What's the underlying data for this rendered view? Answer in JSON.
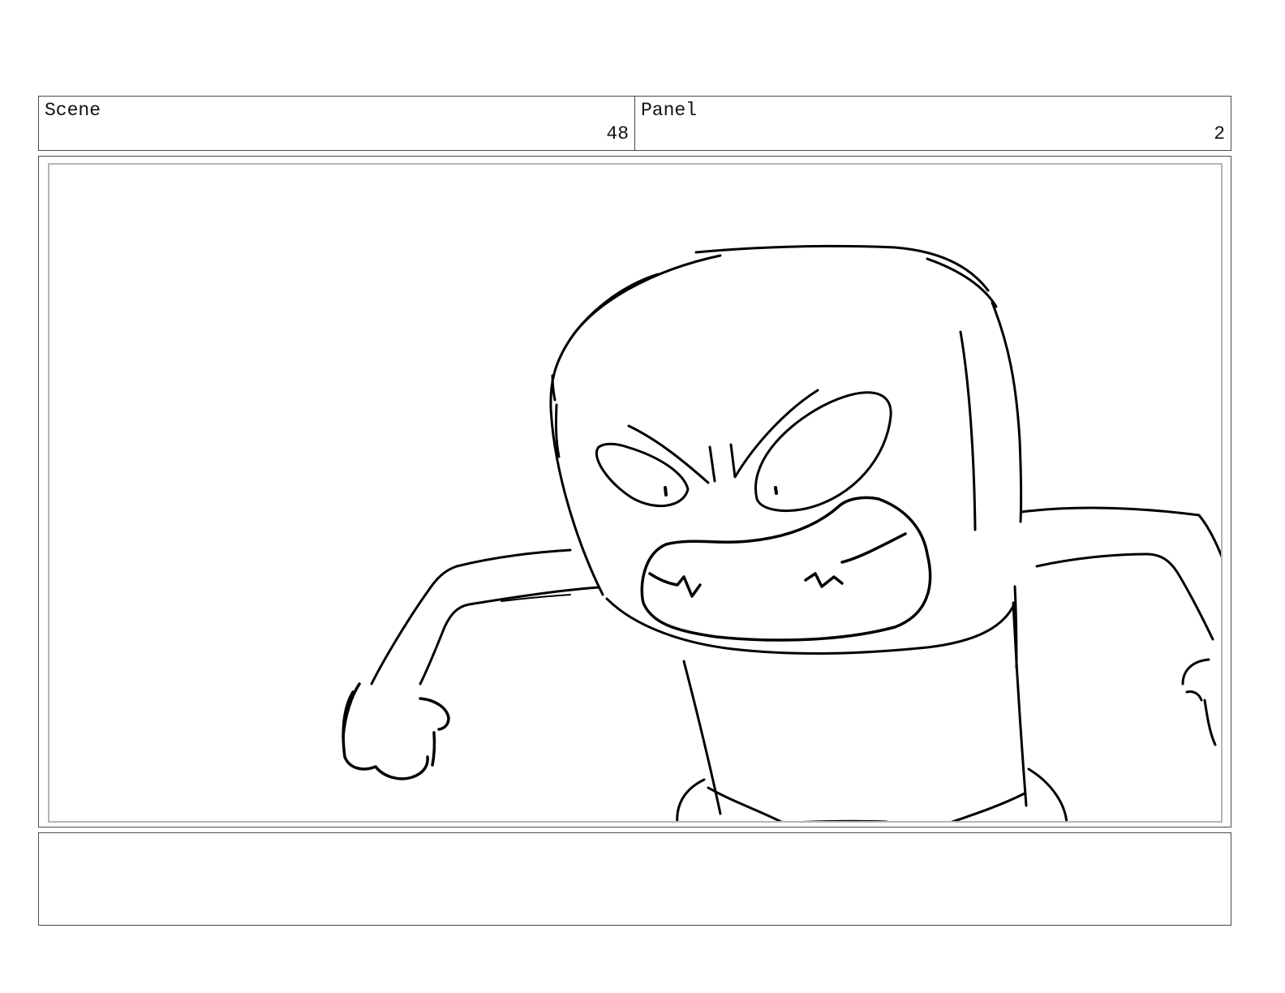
{
  "header": {
    "scene_label": "Scene",
    "scene_number": "48",
    "panel_label": "Panel",
    "panel_number": "2"
  },
  "notes": {
    "text": ""
  }
}
